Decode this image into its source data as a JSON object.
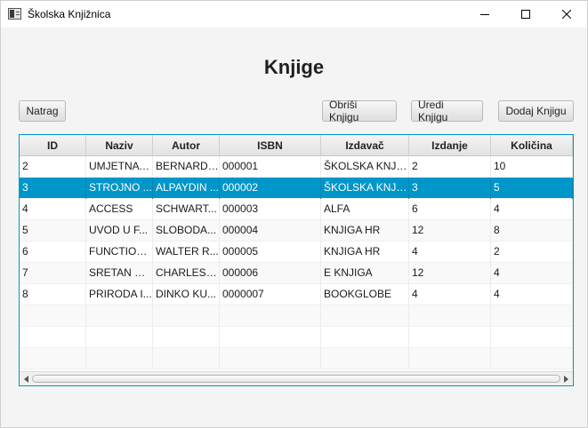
{
  "window": {
    "title": "Školska Knjižnica",
    "icon": "app-window-icon",
    "controls": [
      "minimize-icon",
      "maximize-icon",
      "close-icon"
    ]
  },
  "page": {
    "title": "Knjige"
  },
  "toolbar": {
    "back_label": "Natrag",
    "delete_label": "Obriši Knjigu",
    "edit_label": "Uredi Knjigu",
    "add_label": "Dodaj Knjigu"
  },
  "table": {
    "columns": [
      "ID",
      "Naziv",
      "Autor",
      "ISBN",
      "Izdavač",
      "Izdanje",
      "Količina"
    ],
    "rows": [
      [
        "2",
        "UMJETNA I...",
        "BERNARD ...",
        "000001",
        "ŠKOLSKA KNJIGA",
        "2",
        "10"
      ],
      [
        "3",
        "STROJNO ...",
        "ALPAYDIN ...",
        "000002",
        "ŠKOLSKA KNJIGA",
        "3",
        "5"
      ],
      [
        "4",
        "ACCESS",
        "SCHWART...",
        "000003",
        "ALFA",
        "6",
        "4"
      ],
      [
        "5",
        "UVOD U F...",
        "SLOBODA...",
        "000004",
        "KNJIGA HR",
        "12",
        "8"
      ],
      [
        "6",
        "FUNCTION...",
        "WALTER R...",
        "000005",
        "KNJIGA HR",
        "4",
        "2"
      ],
      [
        "7",
        "SRETAN SL...",
        "CHARLES B...",
        "000006",
        "E KNJIGA",
        "12",
        "4"
      ],
      [
        "8",
        "PRIRODA I...",
        "DINKO KU...",
        "0000007",
        "BOOKGLOBE",
        "4",
        "4"
      ]
    ],
    "selected_row_index": 1,
    "empty_rows": 4,
    "colors": {
      "selection": "#0096c9",
      "border": "#0096c9"
    }
  }
}
